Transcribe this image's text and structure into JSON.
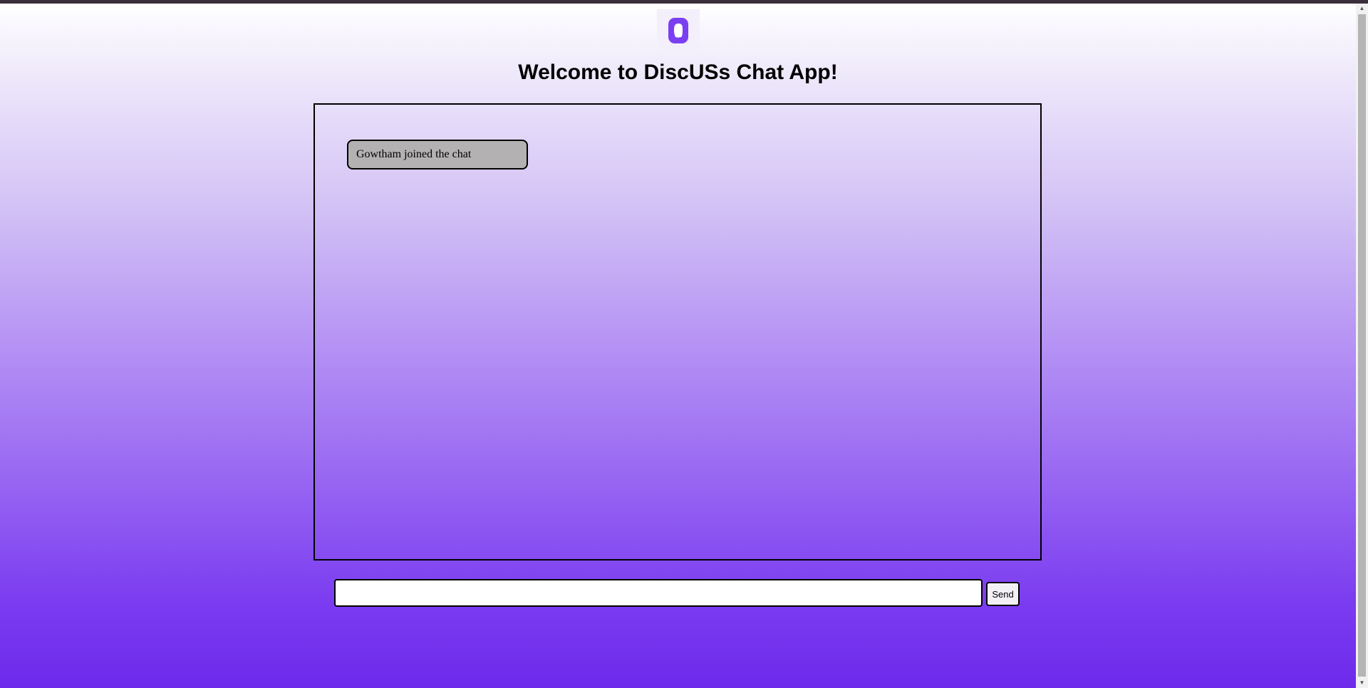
{
  "app": {
    "title": "Welcome to DiscUSs Chat App!",
    "logo_icon": "chat-bubble-icon",
    "brand_color": "#7a3bf0"
  },
  "chat": {
    "messages": [
      {
        "text": "Gowtham joined the chat"
      }
    ]
  },
  "composer": {
    "input_value": "",
    "send_label": "Send"
  },
  "scrollbar": {
    "up_glyph": "▲",
    "down_glyph": "▼"
  }
}
